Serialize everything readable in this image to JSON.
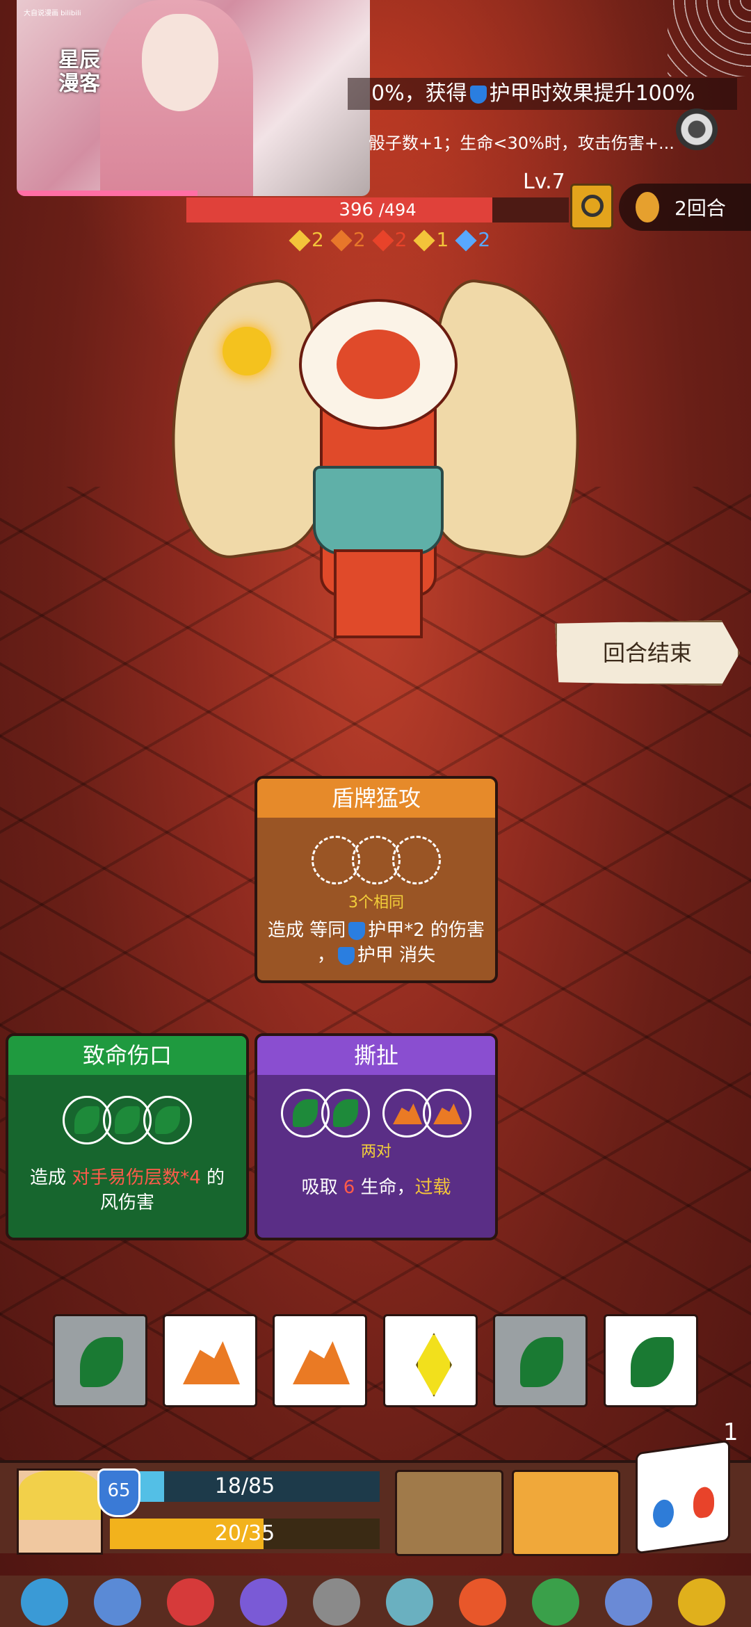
{
  "portrait": {
    "watermark": "大自说漫画 bilibili",
    "tag": "星辰漫客"
  },
  "effects": {
    "line1": "0%，获得",
    "line1_shield": "护甲时效果提升100%",
    "line2": "骰子数+1；生命<30%时，攻击伤害+..."
  },
  "enemy": {
    "level": "Lv.7",
    "hp_current": "396",
    "hp_max": "/494",
    "hp_fraction": 0.8,
    "statuses": [
      {
        "icon": "yellow-diamond-icon",
        "value": "2",
        "color": "#f3c43a"
      },
      {
        "icon": "orange-rock-icon",
        "value": "2",
        "color": "#e8772a"
      },
      {
        "icon": "red-flame-icon",
        "value": "2",
        "color": "#e8432a"
      },
      {
        "icon": "yellow-cube-icon",
        "value": "1",
        "color": "#f3c43a"
      },
      {
        "icon": "snowflake-icon",
        "value": "2",
        "color": "#58a8ff"
      }
    ]
  },
  "round": {
    "label": "2回合"
  },
  "end_turn": {
    "label": "回合结束"
  },
  "cards": {
    "shield_attack": {
      "title": "盾牌猛攻",
      "requirement": "3个相同",
      "desc_line1_a": "造成 等同",
      "desc_line1_b": "护甲*2 的伤害",
      "desc_line2_a": "，",
      "desc_line2_b": "护甲 消失"
    },
    "fatal_wound": {
      "title": "致命伤口",
      "desc_line1_a": "造成 ",
      "desc_line1_b": "对手易伤层数*4",
      "desc_line1_c": " 的",
      "desc_line2": "风伤害"
    },
    "tear": {
      "title": "撕扯",
      "requirement": "两对",
      "desc_a": "吸取 ",
      "desc_b": "6",
      "desc_c": " 生命，",
      "desc_d": "过载"
    }
  },
  "dice": [
    {
      "face": "leaf",
      "state": "grey"
    },
    {
      "face": "rock",
      "state": "white"
    },
    {
      "face": "rock",
      "state": "white"
    },
    {
      "face": "diamond",
      "state": "white"
    },
    {
      "face": "leaf",
      "state": "grey"
    },
    {
      "face": "leaf",
      "state": "white"
    }
  ],
  "player": {
    "armor": "65",
    "hp": "18/85",
    "energy": "20/35",
    "dice_count": "1"
  },
  "relics": [
    "ice-shield-icon",
    "compass-star-icon",
    "red-gem-icon",
    "purple-horn-icon",
    "stone-orb-icon",
    "crystal-skull-icon",
    "lightning-orb-icon",
    "green-book-icon",
    "blue-dagger-icon",
    "golden-bug-icon"
  ]
}
